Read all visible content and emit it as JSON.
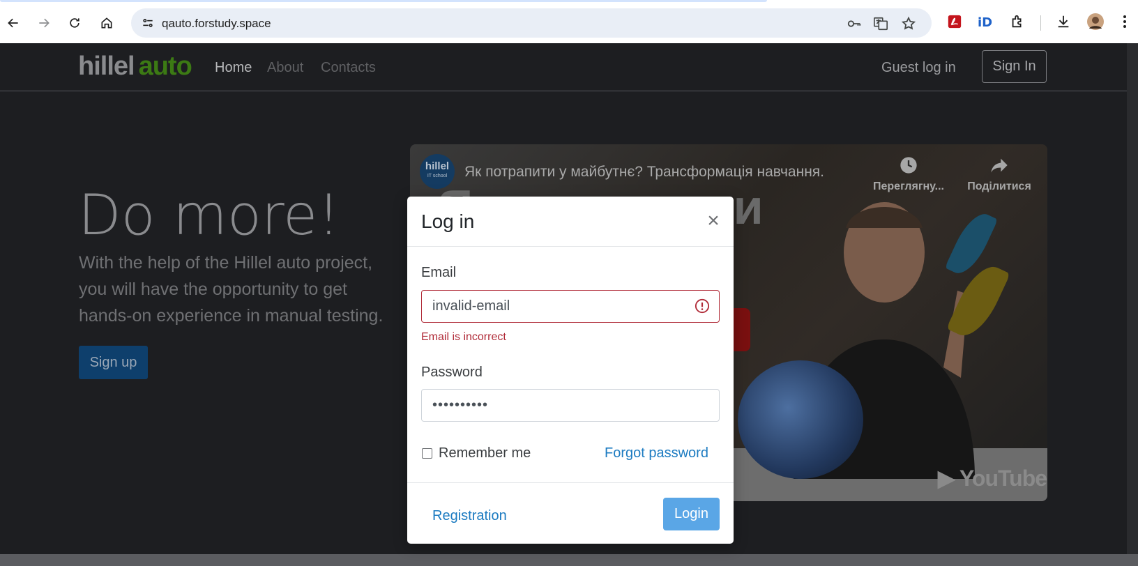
{
  "browser": {
    "url": "qauto.forstudy.space"
  },
  "header": {
    "logo_part1": "hillel",
    "logo_part2": "auto",
    "nav": [
      "Home",
      "About",
      "Contacts"
    ],
    "guest_login": "Guest log in",
    "sign_in": "Sign In"
  },
  "hero": {
    "title": "Do more!",
    "text": "With the help of the Hillel auto project, you will have the opportunity to get hands-on experience in manual testing.",
    "signup": "Sign up"
  },
  "video": {
    "channel_name": "hillel",
    "channel_sub": "IT school",
    "title": "Як потрапити у майбутнє? Трансформація навчання.",
    "big_text": "Як потрапити",
    "watch_later": "Переглягну...",
    "share": "Поділитися",
    "platform": "YouTube"
  },
  "modal": {
    "title": "Log in",
    "close": "×",
    "email_label": "Email",
    "email_value": "invalid-email",
    "email_error": "Email is incorrect",
    "password_label": "Password",
    "password_value": "••••••••••",
    "remember_label": "Remember me",
    "remember_checked": false,
    "forgot_label": "Forgot password",
    "registration_label": "Registration",
    "login_label": "Login"
  },
  "colors": {
    "error": "#b02a37",
    "link": "#1c7bc1",
    "primary_button": "#5aa6e6",
    "logo_green": "#3c7a14"
  }
}
